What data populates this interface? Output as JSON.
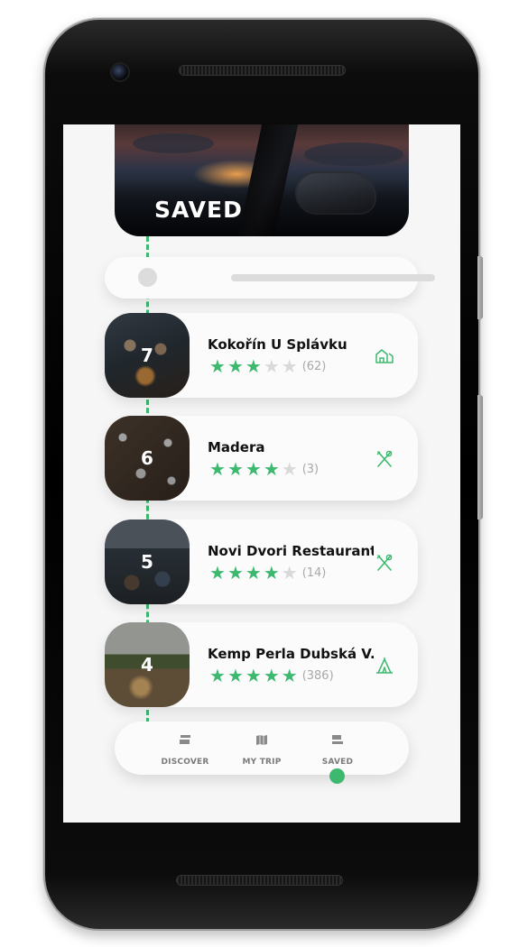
{
  "header": {
    "title": "SAVED"
  },
  "places": [
    {
      "number": "7",
      "name": "Kokořín U Splávku",
      "rating": 3,
      "reviews": "(62)",
      "category_icon": "cabin-icon"
    },
    {
      "number": "6",
      "name": "Madera",
      "rating": 4,
      "reviews": "(3)",
      "category_icon": "restaurant-icon"
    },
    {
      "number": "5",
      "name": "Novi Dvori Restaurant",
      "rating": 4,
      "reviews": "(14)",
      "category_icon": "restaurant-icon"
    },
    {
      "number": "4",
      "name": "Kemp Perla Dubská V..",
      "rating": 5,
      "reviews": "(386)",
      "category_icon": "tent-icon"
    }
  ],
  "nav": {
    "items": [
      {
        "label": "DISCOVER",
        "icon": "discover-icon"
      },
      {
        "label": "MY TRIP",
        "icon": "map-icon"
      },
      {
        "label": "SAVED",
        "icon": "bookmark-icon"
      }
    ],
    "active": "SAVED"
  },
  "colors": {
    "accent": "#3cb96f",
    "star_off": "#d9d9d9",
    "card": "#fbfbfb",
    "background": "#f6f6f6"
  }
}
